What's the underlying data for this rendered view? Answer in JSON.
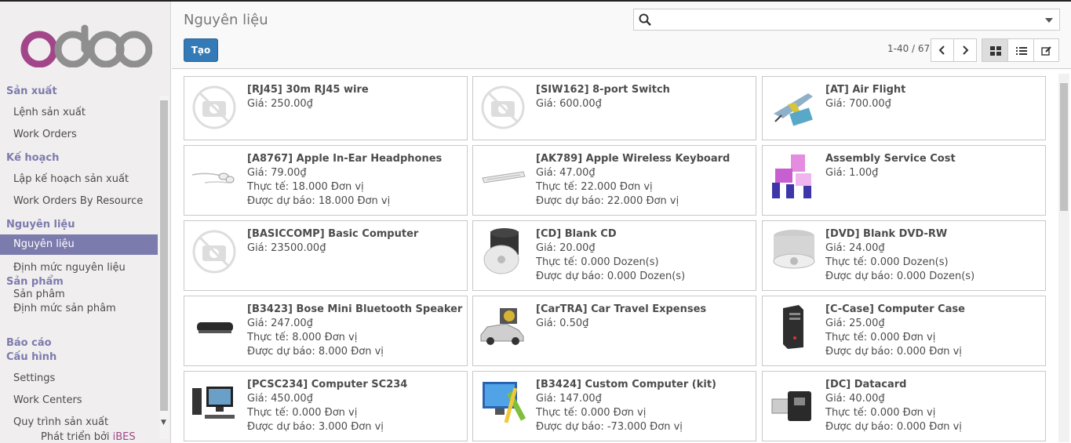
{
  "sidebar": {
    "sections": [
      {
        "label": "Sản xuất",
        "items": [
          "Lệnh sản xuất",
          "Work Orders"
        ]
      },
      {
        "label": "Kế hoạch",
        "items": [
          "Lập kế hoạch sản xuất",
          "Work Orders By Resource"
        ]
      },
      {
        "label": "Nguyên liệu",
        "items": [
          "Nguyên liệu",
          "Định mức nguyên liệu"
        ]
      },
      {
        "label": "Sản phẩm",
        "items": [
          "Sản phâm",
          "Định mức sản phâm"
        ]
      },
      {
        "label": "Báo cáo",
        "items": []
      },
      {
        "label": "Cấu hình",
        "items": [
          "Settings",
          "Work Centers",
          "Quy trình sản xuất"
        ]
      }
    ],
    "footer_prefix": "Phát triển bởi",
    "footer_brand": "iBES"
  },
  "header": {
    "title": "Nguyên liệu",
    "search_placeholder": "",
    "create_label": "Tạo",
    "pager": "1-40 / 67"
  },
  "cards": [
    {
      "name": "[RJ45] 30m RJ45 wire",
      "price": "Giá: 250.00₫",
      "onhand": "",
      "forecast": "",
      "icon": "no-image-icon"
    },
    {
      "name": "[SIW162] 8-port Switch",
      "price": "Giá: 600.00₫",
      "onhand": "",
      "forecast": "",
      "icon": "no-image-icon"
    },
    {
      "name": "[AT] Air Flight",
      "price": "Giá: 700.00₫",
      "onhand": "",
      "forecast": "",
      "icon": "airplane-icon"
    },
    {
      "name": "[A8767] Apple In-Ear Headphones",
      "price": "Giá: 79.00₫",
      "onhand": "Thực tế: 18.000 Đơn vị",
      "forecast": "Được dự báo: 18.000 Đơn vị",
      "icon": "headphones-icon"
    },
    {
      "name": "[AK789] Apple Wireless Keyboard",
      "price": "Giá: 47.00₫",
      "onhand": "Thực tế: 22.000 Đơn vị",
      "forecast": "Được dự báo: 22.000 Đơn vị",
      "icon": "keyboard-icon"
    },
    {
      "name": "Assembly Service Cost",
      "price": "Giá: 1.00₫",
      "onhand": "",
      "forecast": "",
      "icon": "assembly-icon"
    },
    {
      "name": "[BASICCOMP] Basic Computer",
      "price": "Giá: 23500.00₫",
      "onhand": "",
      "forecast": "",
      "icon": "no-image-icon"
    },
    {
      "name": "[CD] Blank CD",
      "price": "Giá: 20.00₫",
      "onhand": "Thực tế: 0.000 Dozen(s)",
      "forecast": "Được dự báo: 0.000 Dozen(s)",
      "icon": "cd-icon"
    },
    {
      "name": "[DVD] Blank DVD-RW",
      "price": "Giá: 24.00₫",
      "onhand": "Thực tế: 0.000 Dozen(s)",
      "forecast": "Được dự báo: 0.000 Dozen(s)",
      "icon": "dvd-icon"
    },
    {
      "name": "[B3423] Bose Mini Bluetooth Speaker",
      "price": "Giá: 247.00₫",
      "onhand": "Thực tế: 8.000 Đơn vị",
      "forecast": "Được dự báo: 8.000 Đơn vị",
      "icon": "speaker-icon"
    },
    {
      "name": "[CarTRA] Car Travel Expenses",
      "price": "Giá: 0.50₫",
      "onhand": "",
      "forecast": "",
      "icon": "car-icon"
    },
    {
      "name": "[C-Case] Computer Case",
      "price": "Giá: 25.00₫",
      "onhand": "Thực tế: 0.000 Đơn vị",
      "forecast": "Được dự báo: 0.000 Đơn vị",
      "icon": "computer-case-icon"
    },
    {
      "name": "[PCSC234] Computer SC234",
      "price": "Giá: 450.00₫",
      "onhand": "Thực tế: 0.000 Đơn vị",
      "forecast": "Được dự báo: 3.000 Đơn vị",
      "icon": "desktop-computer-icon"
    },
    {
      "name": "[B3424] Custom Computer (kit)",
      "price": "Giá: 147.00₫",
      "onhand": "Thực tế: 0.000 Đơn vị",
      "forecast": "Được dự báo: -73.000 Đơn vị",
      "icon": "computer-kit-icon"
    },
    {
      "name": "[DC] Datacard",
      "price": "Giá: 40.00₫",
      "onhand": "Thực tế: 0.000 Đơn vị",
      "forecast": "Được dự báo: 0.000 Đơn vị",
      "icon": "datacard-icon"
    }
  ]
}
